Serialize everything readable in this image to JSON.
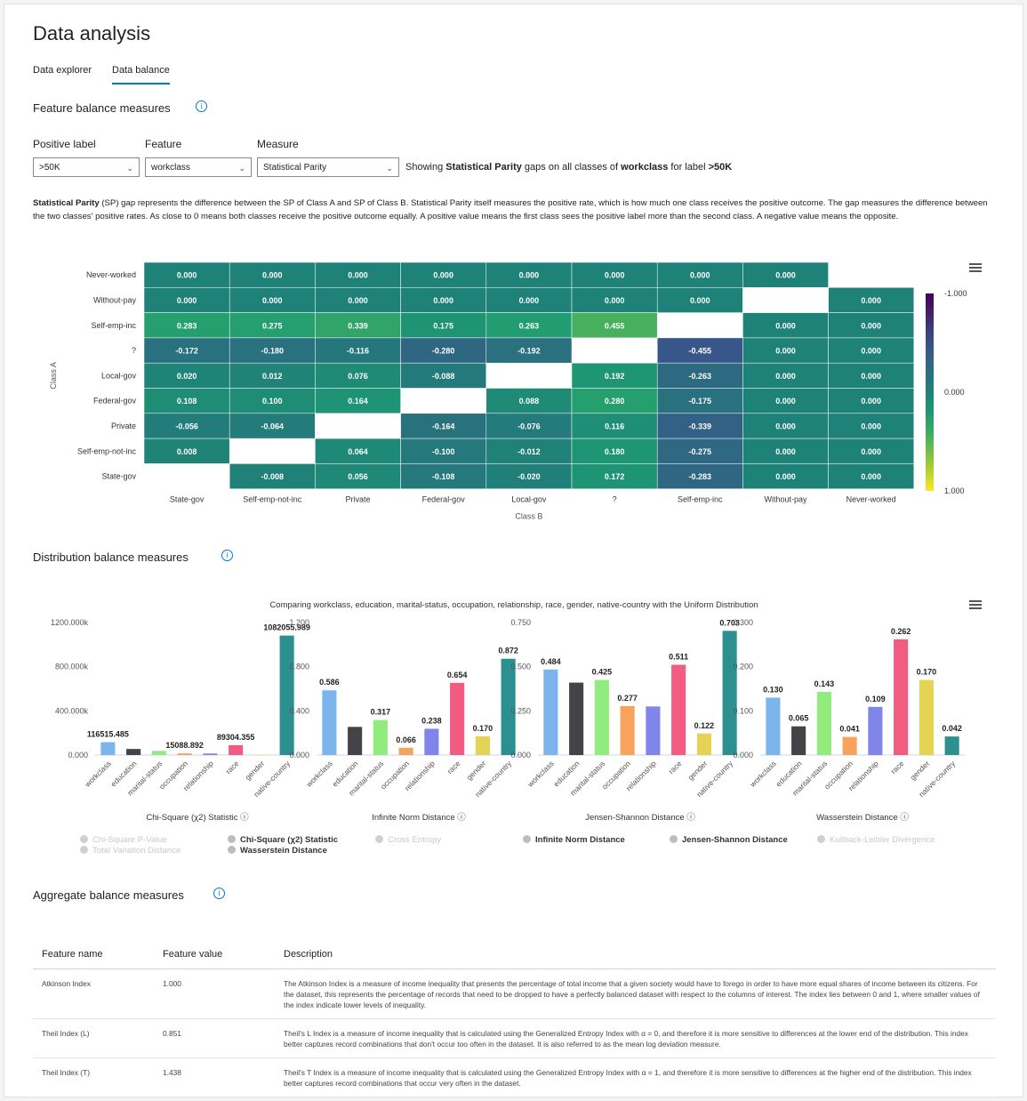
{
  "page": {
    "title": "Data analysis"
  },
  "tabs": [
    {
      "label": "Data explorer"
    },
    {
      "label": "Data balance"
    }
  ],
  "feature_balance": {
    "title": "Feature balance measures",
    "positive_label": {
      "label": "Positive label",
      "value": ">50K"
    },
    "feature": {
      "label": "Feature",
      "value": "workclass"
    },
    "measure": {
      "label": "Measure",
      "value": "Statistical Parity"
    },
    "showing": {
      "p1": "Showing ",
      "measure": "Statistical Parity",
      "p2": " gaps on all classes of ",
      "feature": "workclass",
      "p3": " for label ",
      "label": ">50K"
    },
    "description_parts": {
      "term": "Statistical Parity",
      "rest": " (SP) gap represents the difference between the SP of Class A and SP of Class B. Statistical Parity itself measures the positive rate, which is how much one class receives the positive outcome. The gap measures the difference between the two classes' positive rates. As close to 0 means both classes receive the positive outcome equally. A positive value means the first class sees the positive label more than the second class. A negative value means the opposite."
    }
  },
  "distribution_balance": {
    "title": "Distribution balance measures"
  },
  "aggregate_balance": {
    "title": "Aggregate balance measures",
    "columns": [
      "Feature name",
      "Feature value",
      "Description"
    ],
    "rows": [
      {
        "name": "Atkinson Index",
        "value": "1.000",
        "description": "The Atkinson Index is a measure of income inequality that presents the percentage of total income that a given society would have to forego in order to have more equal shares of income between its citizens. For the dataset, this represents the percentage of records that need to be dropped to have a perfectly balanced dataset with respect to the columns of interest. The index lies between 0 and 1, where smaller values of the index indicate lower levels of inequality."
      },
      {
        "name": "Theil Index (L)",
        "value": "0.851",
        "description": "Theil's L Index is a measure of income inequality that is calculated using the Generalized Entropy Index with α = 0, and therefore it is more sensitive to differences at the lower end of the distribution. This index better captures record combinations that don't occur too often in the dataset. It is also referred to as the mean log deviation measure."
      },
      {
        "name": "Theil Index (T)",
        "value": "1.438",
        "description": "Theil's T Index is a measure of income inequality that is calculated using the Generalized Entropy Index with α = 1, and therefore it is more sensitive to differences at the higher end of the distribution. This index better captures record combinations that occur very often in the dataset."
      }
    ]
  },
  "legend": [
    {
      "label": "Chi-Square P-Value",
      "active": false
    },
    {
      "label": "Total Variation Distance",
      "active": false
    },
    {
      "label": "Chi-Square (χ2) Statistic",
      "active": true
    },
    {
      "label": "Wasserstein Distance",
      "active": true
    },
    {
      "label": "Cross Entropy",
      "active": false
    },
    {
      "label": "Infinite Norm Distance",
      "active": true
    },
    {
      "label": "Jensen-Shannon Distance",
      "active": true
    },
    {
      "label": "Kullback-Leibler Divergence",
      "active": false
    }
  ],
  "chart_data": [
    {
      "type": "heatmap",
      "xlabel": "Class B",
      "ylabel": "Class A",
      "x_categories": [
        "State-gov",
        "Self-emp-not-inc",
        "Private",
        "Federal-gov",
        "Local-gov",
        "?",
        "Self-emp-inc",
        "Without-pay",
        "Never-worked"
      ],
      "y_categories": [
        "Never-worked",
        "Without-pay",
        "Self-emp-inc",
        "?",
        "Local-gov",
        "Federal-gov",
        "Private",
        "Self-emp-not-inc",
        "State-gov"
      ],
      "values": [
        [
          0.0,
          0.0,
          0.0,
          0.0,
          0.0,
          0.0,
          0.0,
          0.0,
          null
        ],
        [
          0.0,
          0.0,
          0.0,
          0.0,
          0.0,
          0.0,
          0.0,
          null,
          0.0
        ],
        [
          0.283,
          0.275,
          0.339,
          0.175,
          0.263,
          0.455,
          null,
          0.0,
          0.0
        ],
        [
          -0.172,
          -0.18,
          -0.116,
          -0.28,
          -0.192,
          null,
          -0.455,
          0.0,
          0.0
        ],
        [
          0.02,
          0.012,
          0.076,
          -0.088,
          null,
          0.192,
          -0.263,
          0.0,
          0.0
        ],
        [
          0.108,
          0.1,
          0.164,
          null,
          0.088,
          0.28,
          -0.175,
          0.0,
          0.0
        ],
        [
          -0.056,
          -0.064,
          null,
          -0.164,
          -0.076,
          0.116,
          -0.339,
          0.0,
          0.0
        ],
        [
          0.008,
          null,
          0.064,
          -0.1,
          -0.012,
          0.18,
          -0.275,
          0.0,
          0.0
        ],
        [
          null,
          -0.008,
          0.056,
          -0.108,
          -0.02,
          0.172,
          -0.283,
          0.0,
          0.0
        ]
      ],
      "colorbar": {
        "labels": [
          "-1.000",
          "0.000",
          "1.000"
        ],
        "range": [
          -1,
          1
        ]
      }
    },
    {
      "type": "bar",
      "title": "Comparing workclass, education, marital-status, occupation, relationship, race, gender, native-country with the Uniform Distribution",
      "categories": [
        "workclass",
        "education",
        "marital-status",
        "occupation",
        "relationship",
        "race",
        "gender",
        "native-country"
      ],
      "colors": [
        "#7cb5ec",
        "#434348",
        "#90ed7d",
        "#f7a35c",
        "#8085e9",
        "#f15c80",
        "#e4d354",
        "#2b908f"
      ],
      "panels": [
        {
          "name": "Chi-Square (χ2) Statistic",
          "ylim": [
            0,
            1200000
          ],
          "ticks": [
            "0.000",
            "400.000k",
            "800.000k",
            "1200.000k"
          ],
          "values": [
            116515.485,
            55000,
            38000,
            15088.892,
            14000,
            89304.355,
            3000,
            1082055.989
          ],
          "labels": [
            "116515.485",
            null,
            null,
            "15088.892",
            null,
            "89304.355",
            null,
            "1082055.989"
          ]
        },
        {
          "name": "Infinite Norm Distance",
          "ylim": [
            0,
            1.2
          ],
          "ticks": [
            "0.000",
            "0.400",
            "0.800",
            "1.200"
          ],
          "values": [
            0.586,
            0.255,
            0.317,
            0.066,
            0.238,
            0.654,
            0.17,
            0.872
          ],
          "labels": [
            "0.586",
            null,
            "0.317",
            "0.066",
            "0.238",
            "0.654",
            "0.170",
            "0.872"
          ]
        },
        {
          "name": "Jensen-Shannon Distance",
          "ylim": [
            0,
            0.75
          ],
          "ticks": [
            "0.000",
            "0.250",
            "0.500",
            "0.750"
          ],
          "values": [
            0.484,
            0.41,
            0.425,
            0.277,
            0.275,
            0.511,
            0.122,
            0.703
          ],
          "labels": [
            "0.484",
            null,
            "0.425",
            "0.277",
            null,
            "0.511",
            "0.122",
            "0.703"
          ]
        },
        {
          "name": "Wasserstein Distance",
          "ylim": [
            0,
            0.3
          ],
          "ticks": [
            "0.000",
            "0.100",
            "0.200",
            "0.300"
          ],
          "values": [
            0.13,
            0.065,
            0.143,
            0.041,
            0.109,
            0.262,
            0.17,
            0.042
          ],
          "labels": [
            "0.130",
            "0.065",
            "0.143",
            "0.041",
            "0.109",
            "0.262",
            "0.170",
            "0.042"
          ]
        }
      ]
    }
  ]
}
